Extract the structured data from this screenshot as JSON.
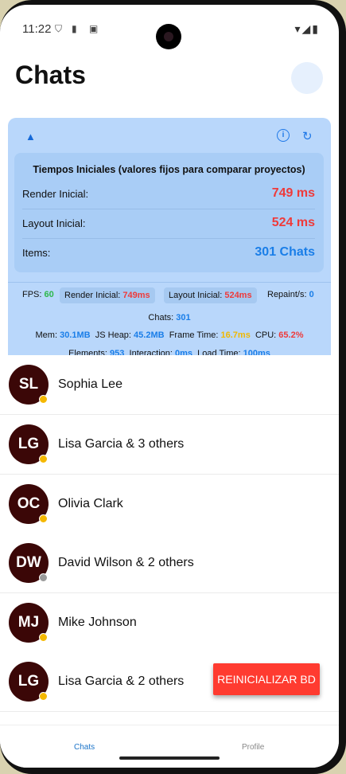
{
  "status": {
    "time": "11:22"
  },
  "header": {
    "title": "Chats"
  },
  "panel": {
    "title": "Tiempos Iniciales (valores fijos para comparar proyectos)",
    "rows": [
      {
        "label": "Render Inicial:",
        "value": "749 ms"
      },
      {
        "label": "Layout Inicial:",
        "value": "524 ms"
      },
      {
        "label": "Items:",
        "value": "301 Chats"
      }
    ],
    "stats": {
      "fps_label": "FPS:",
      "fps": "60",
      "render_label": "Render Inicial:",
      "render": "749ms",
      "layout_label": "Layout Inicial:",
      "layout": "524ms",
      "repaint_label": "Repaint/s:",
      "repaint": "0",
      "chats_label": "Chats:",
      "chats": "301",
      "mem_label": "Mem:",
      "mem": "30.1MB",
      "heap_label": "JS Heap:",
      "heap": "45.2MB",
      "frame_label": "Frame Time:",
      "frame": "16.7ms",
      "cpu_label": "CPU:",
      "cpu": "65.2%",
      "elements_label": "Elements:",
      "elements": "953",
      "interaction_label": "Interaction:",
      "interaction": "0ms",
      "load_label": "Load Time:",
      "load": "100ms"
    }
  },
  "chats": [
    {
      "initials": "SL",
      "name": "Sophia Lee",
      "status_color": "#f5b800"
    },
    {
      "initials": "LG",
      "name": "Lisa Garcia & 3 others",
      "status_color": "#f5b800"
    },
    {
      "initials": "OC",
      "name": "Olivia Clark",
      "status_color": "#f5b800"
    },
    {
      "initials": "DW",
      "name": "David Wilson & 2 others",
      "status_color": "#9a9a9a"
    },
    {
      "initials": "MJ",
      "name": "Mike Johnson",
      "status_color": "#f5b800"
    },
    {
      "initials": "LG",
      "name": "Lisa Garcia & 2 others",
      "status_color": "#f5b800"
    }
  ],
  "reset_button": "REINICIALIZAR BD",
  "tabs": [
    {
      "label": "Chats",
      "color": "#1a73c8"
    },
    {
      "label": "Profile",
      "color": "#888888"
    }
  ],
  "colors": {
    "accent": "#1a7ee8",
    "danger": "#ef3a3a",
    "avatar_bg": "#3b0707",
    "panel_bg": "#b9d7fb"
  }
}
